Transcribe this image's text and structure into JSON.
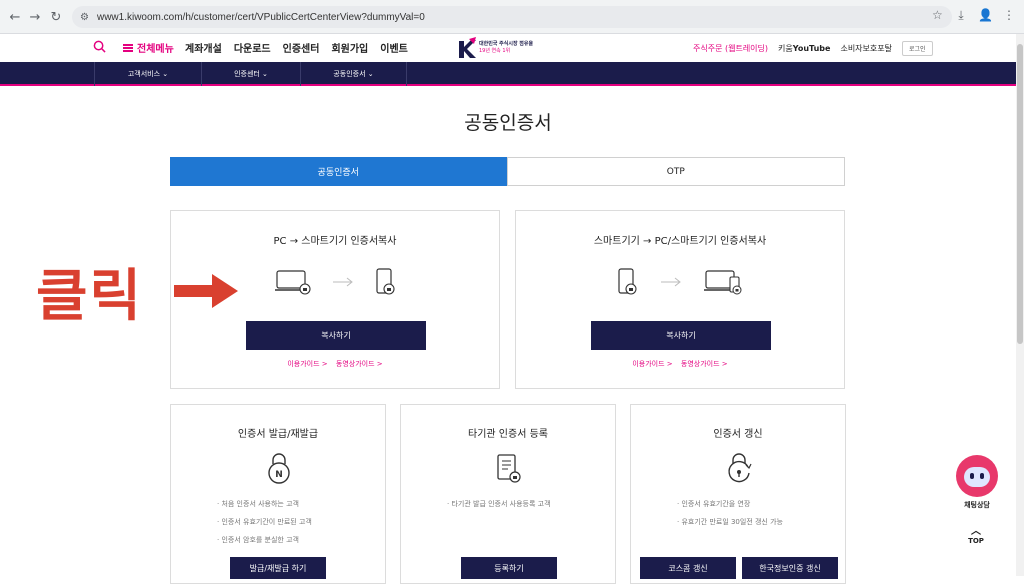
{
  "browser": {
    "url": "www1.kiwoom.com/h/customer/cert/VPublicCertCenterView?dummyVal=0",
    "back_icon": "←",
    "forward_icon": "→",
    "reload_icon": "↻",
    "star_icon": "☆",
    "download_icon": "⤓",
    "profile_icon": "👤",
    "more_icon": "⋮"
  },
  "header": {
    "all_menu_label": "전체메뉴",
    "top_menu": [
      "계좌개설",
      "다운로드",
      "인증센터",
      "회원가입",
      "이벤트"
    ],
    "logo": {
      "line1": "대한민국 주식시장 점유율",
      "line2": "19년 연속 1위"
    },
    "trade_label": "주식주문 (웹트레이딩)",
    "youtube_prefix": "키움",
    "youtube_label": "YouTube",
    "consumer_portal": "소비자보호포탈",
    "login_label": "로그인"
  },
  "subnav": [
    "고객서비스 ⌄",
    "인증센터 ⌄",
    "공동인증서 ⌄"
  ],
  "page_title": "공동인증서",
  "tabs": [
    {
      "label": "공동인증서",
      "active": true
    },
    {
      "label": "OTP",
      "active": false
    }
  ],
  "cards_top": [
    {
      "title": "PC → 스마트기기 인증서복사",
      "button": "복사하기",
      "links": [
        "이용가이드 >",
        "동영상가이드 >"
      ]
    },
    {
      "title": "스마트기기 → PC/스마트기기 인증서복사",
      "button": "복사하기",
      "links": [
        "이용가이드 >",
        "동영상가이드 >"
      ]
    }
  ],
  "cards_bottom": [
    {
      "title": "인증서 발급/재발급",
      "bullets": [
        "처음 인증서 사용하는 고객",
        "인증서 유효기간이 만료된 고객",
        "인증서 암호를 분실한 고객"
      ],
      "buttons": [
        "발급/재발급 하기"
      ]
    },
    {
      "title": "타기관 인증서 등록",
      "bullets": [
        "타기관 발급 인증서 사용등록 고객"
      ],
      "buttons": [
        "등록하기"
      ]
    },
    {
      "title": "인증서 갱신",
      "bullets": [
        "인증서 유효기간을 연장",
        "유효기간 만료일 30일전 갱신 가능"
      ],
      "buttons": [
        "코스콤 갱신",
        "한국정보인증 갱신"
      ]
    }
  ],
  "overlay": {
    "text": "클릭",
    "color": "#d9402f"
  },
  "chatbot_label": "채팅상담",
  "top_label": "TOP",
  "colors": {
    "navy": "#1b1c4b",
    "accent": "#e4007f",
    "tab_active": "#1f77d2"
  }
}
